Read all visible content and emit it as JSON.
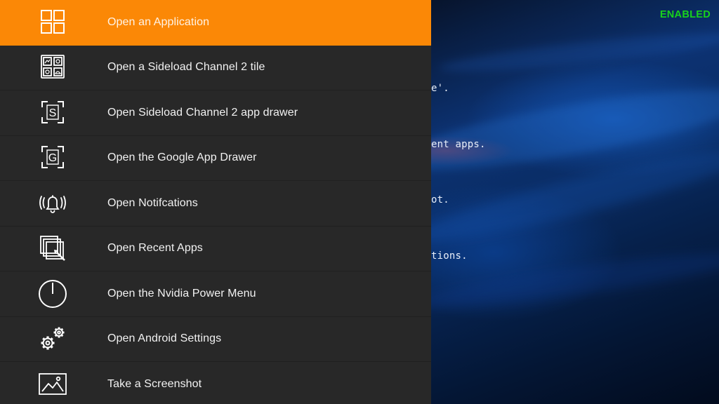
{
  "menu": {
    "items": [
      {
        "label": "Open an Application",
        "icon": "grid-icon",
        "selected": true
      },
      {
        "label": "Open a Sideload Channel 2 tile",
        "icon": "tiles-icon",
        "selected": false
      },
      {
        "label": "Open Sideload Channel 2 app drawer",
        "icon": "s-drawer-icon",
        "selected": false
      },
      {
        "label": "Open the Google App Drawer",
        "icon": "g-drawer-icon",
        "selected": false
      },
      {
        "label": "Open Notifcations",
        "icon": "bell-ringing-icon",
        "selected": false
      },
      {
        "label": "Open Recent Apps",
        "icon": "recent-apps-icon",
        "selected": false
      },
      {
        "label": "Open the Nvidia Power Menu",
        "icon": "power-icon",
        "selected": false
      },
      {
        "label": "Open Android Settings",
        "icon": "gears-icon",
        "selected": false
      },
      {
        "label": "Take a Screenshot",
        "icon": "image-icon",
        "selected": false
      }
    ]
  },
  "background": {
    "status": "ENABLED",
    "console_lines": [
      "e'.",
      "ent apps.",
      "ot.",
      "tions."
    ]
  },
  "colors": {
    "accent": "#fb8806",
    "menu_bg": "#282828",
    "status_green": "#18d21c"
  }
}
